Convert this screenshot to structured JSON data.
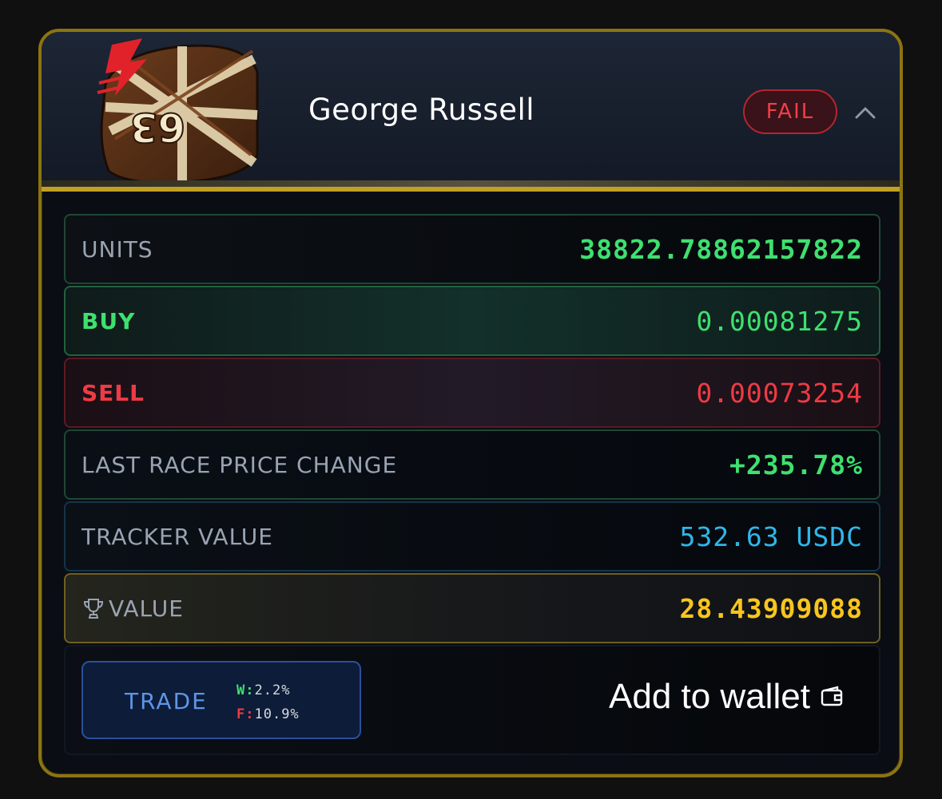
{
  "driver": {
    "name": "George Russell",
    "helmet_number": "63",
    "status_badge": "FAIL",
    "collapse_icon": "chevron-up-icon"
  },
  "rows": {
    "units": {
      "label": "UNITS",
      "value": "38822.78862157822"
    },
    "buy": {
      "label": "BUY",
      "value": "0.00081275"
    },
    "sell": {
      "label": "SELL",
      "value": "0.00073254"
    },
    "last_race_price_change": {
      "label": "LAST RACE PRICE CHANGE",
      "value": "+235.78%"
    },
    "tracker_value": {
      "label": "TRACKER VALUE",
      "value": "532.63 USDC"
    },
    "trophy_value": {
      "label": "VALUE",
      "value": "28.43909088",
      "icon": "trophy-icon"
    }
  },
  "actions": {
    "trade_label": "TRADE",
    "win_key": "W:",
    "win_value": "2.2%",
    "fail_key": "F:",
    "fail_value": "10.9%",
    "add_to_wallet_label": "Add to wallet",
    "wallet_icon": "wallet-icon"
  },
  "colors": {
    "accent_gold": "#c1a023",
    "positive_green": "#3ee06f",
    "negative_red": "#ef3a44",
    "info_blue": "#2fb7e9",
    "trophy_yellow": "#f7c51e",
    "trade_blue": "#5f95e8"
  }
}
